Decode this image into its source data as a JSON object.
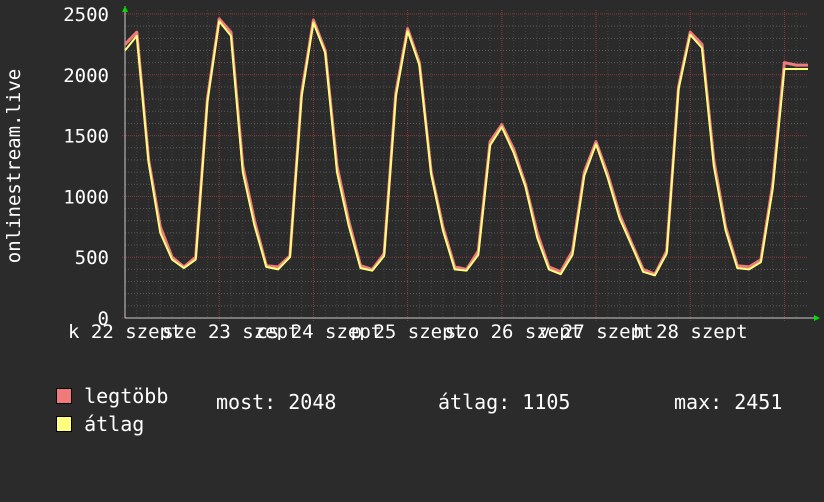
{
  "chart_data": {
    "type": "line",
    "ylabel": "onlinestream.live",
    "ylim": [
      0,
      2500
    ],
    "yticks": [
      0,
      500,
      1000,
      1500,
      2000,
      2500
    ],
    "xlim": [
      0,
      174
    ],
    "xtick_labels": [
      "k 22 szept",
      "sze 23 szept",
      "cs 24 szept",
      "p 25 szept",
      "szo 26 szept",
      "v 27 szept",
      "h 28 szept"
    ],
    "grid": true,
    "legend_position": "bottom-left",
    "x": [
      0,
      3,
      6,
      9,
      12,
      15,
      18,
      21,
      24,
      27,
      30,
      33,
      36,
      39,
      42,
      45,
      48,
      51,
      54,
      57,
      60,
      63,
      66,
      69,
      72,
      75,
      78,
      81,
      84,
      87,
      90,
      93,
      96,
      99,
      102,
      105,
      108,
      111,
      114,
      117,
      120,
      123,
      126,
      129,
      132,
      135,
      138,
      141,
      144,
      147,
      150,
      153,
      156,
      159,
      162,
      165,
      168,
      171,
      174
    ],
    "series": [
      {
        "name": "legtöbb",
        "color": "#f07a7a",
        "values": [
          2250,
          2350,
          1300,
          750,
          500,
          420,
          500,
          1800,
          2460,
          2350,
          1250,
          800,
          430,
          420,
          510,
          1850,
          2450,
          2200,
          1250,
          800,
          430,
          400,
          530,
          1850,
          2380,
          2100,
          1200,
          750,
          420,
          400,
          550,
          1450,
          1590,
          1390,
          1100,
          700,
          420,
          380,
          550,
          1200,
          1450,
          1180,
          850,
          620,
          400,
          360,
          550,
          1900,
          2350,
          2250,
          1300,
          750,
          430,
          420,
          480,
          1100,
          2100,
          2080,
          2080
        ]
      },
      {
        "name": "átlag",
        "color": "#ffff80",
        "values": [
          2200,
          2320,
          1280,
          700,
          480,
          410,
          480,
          1780,
          2440,
          2320,
          1200,
          760,
          420,
          400,
          500,
          1820,
          2430,
          2180,
          1200,
          760,
          410,
          390,
          510,
          1820,
          2360,
          2080,
          1180,
          720,
          400,
          390,
          520,
          1420,
          1570,
          1360,
          1080,
          660,
          400,
          360,
          520,
          1170,
          1430,
          1150,
          820,
          600,
          380,
          350,
          530,
          1880,
          2330,
          2220,
          1250,
          720,
          410,
          400,
          460,
          1060,
          2048,
          2048,
          2048
        ]
      }
    ]
  },
  "legend": [
    {
      "label": "legtöbb",
      "color": "#f07a7a"
    },
    {
      "label": "átlag",
      "color": "#ffff80"
    }
  ],
  "stats": {
    "most": "most: 2048",
    "atlag": "átlag: 1105",
    "max": "max: 2451"
  }
}
